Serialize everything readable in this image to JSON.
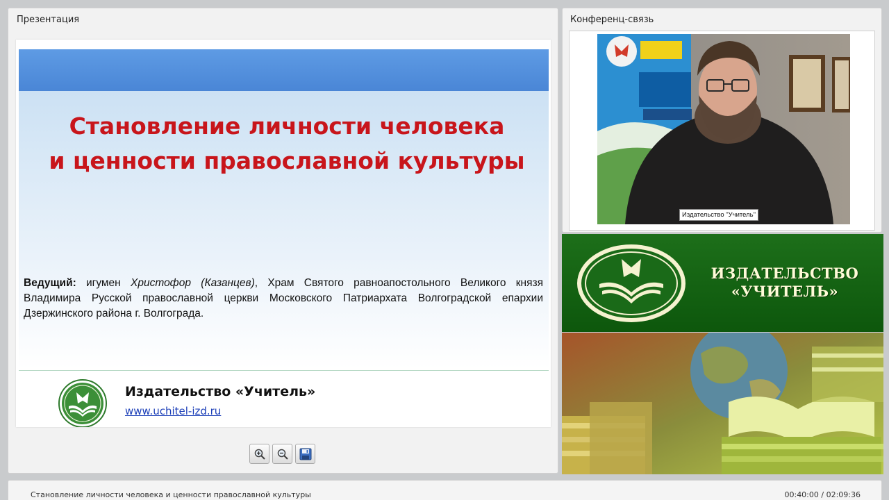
{
  "presentation": {
    "panel_title": "Презентация",
    "slide": {
      "heading_line1": "Становление личности человека",
      "heading_line2": "и ценности православной культуры",
      "presenter_label": "Ведущий:",
      "presenter_pre": "игумен",
      "presenter_name": "Христофор (Казанцев)",
      "presenter_rest": ", Храм Святого равноапостольного Великого князя Владимира Русской православной церкви Московского Патриархата Волгоградской епархии Дзержинского района г. Волгограда.",
      "publisher": "Издательство «Учитель»",
      "url": "www.uchitel-izd.ru",
      "heading_color": "#c8151b",
      "band_color": "#4a86d6"
    },
    "toolbar": {
      "zoom_in_icon": "zoom-in-icon",
      "zoom_out_icon": "zoom-out-icon",
      "save_icon": "floppy-disk-icon"
    }
  },
  "conference": {
    "panel_title": "Конференц-связь",
    "video_caption": "Издательство \"Учитель\""
  },
  "ad": {
    "line1": "ИЗДАТЕЛЬСТВО",
    "line2": "«УЧИТЕЛЬ»",
    "brand_color": "#0d570c",
    "text_color": "#fffbd8"
  },
  "footer": {
    "title": "Становление личности человека и ценности православной культуры",
    "time": "00:40:00 / 02:09:36"
  }
}
